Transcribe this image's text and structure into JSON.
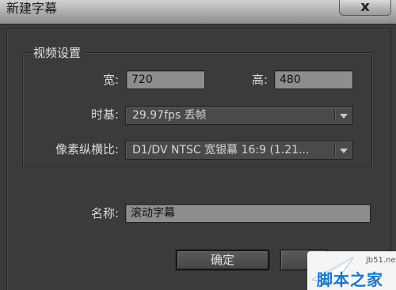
{
  "window": {
    "title": "新建字幕",
    "close_label": "x"
  },
  "video_settings": {
    "group_title": "视频设置",
    "width_label": "宽:",
    "width_value": "720",
    "height_label": "高:",
    "height_value": "480",
    "timebase_label": "时基:",
    "timebase_value": "29.97fps 丢帧",
    "pixel_aspect_label": "像素纵横比:",
    "pixel_aspect_value": "D1/DV NTSC 宽银幕 16:9 (1.21..."
  },
  "name": {
    "label": "名称:",
    "value": "滚动字幕"
  },
  "buttons": {
    "ok_label": "确定",
    "cancel_label": ""
  },
  "watermark": {
    "small_text": "jb51.net",
    "big_text": "脚本之家"
  },
  "icons": {
    "close": "close-icon",
    "dropdown": "chevron-down-icon"
  },
  "colors": {
    "dialog_bg": "#3b3b3b",
    "field_bg": "#8d8d8d",
    "dropdown_bg": "#4a4a4a",
    "watermark_blue": "#1d74c4"
  }
}
